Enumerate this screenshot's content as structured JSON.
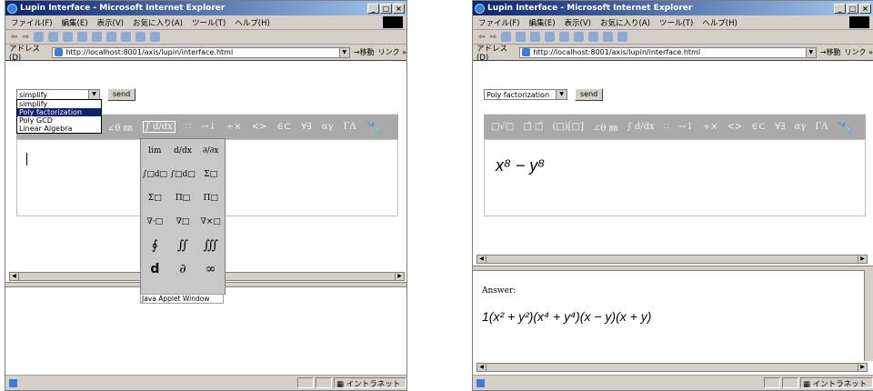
{
  "window": {
    "title": "Lupin Interface - Microsoft Internet Explorer",
    "menu": [
      "ファイル(F)",
      "編集(E)",
      "表示(V)",
      "お気に入り(A)",
      "ツール(T)",
      "ヘルプ(H)"
    ],
    "address_label": "アドレス(D)",
    "url": "http://localhost:8001/axis/lupin/interface.html",
    "go_label": "移動",
    "links_label": "リンク »",
    "status_zone": "イントラネット"
  },
  "left": {
    "select_value": "simplify",
    "send_label": "send",
    "options": [
      "simplify",
      "Poly factorization",
      "Poly GCD",
      "Linear Algebra"
    ],
    "selected_option": "Poly factorization",
    "palette_visible": [
      "∠θ ㎜",
      "∫ d/dx",
      "∷",
      "→↓",
      "÷×",
      "<>",
      "∈⊂",
      "∀∃",
      "αγ",
      "ΓΛ"
    ],
    "popup_symbols": [
      "lim",
      "d/dx",
      "∂/∂x",
      "∫□d□",
      "∫□d□",
      "Σ□",
      "Σ□",
      "Π□",
      "Π□",
      "∇·□",
      "∇□",
      "∇×□",
      "∮",
      "∬",
      "∭",
      "d",
      "∂",
      "∞"
    ],
    "popup_label": "Java Applet Window"
  },
  "right": {
    "select_value": "Poly factorization",
    "send_label": "send",
    "palette": [
      "□√□",
      "□̄ □̂",
      "(□)[□]",
      "∠θ ㎜",
      "∫ d/dx",
      "∷",
      "→↓",
      "÷×",
      "<>",
      "∈⊂",
      "∀∃",
      "αγ",
      "ΓΛ"
    ],
    "expression": "x⁸ − y⁸",
    "answer_label": "Answer:",
    "answer": "1(x² + y²)(x⁴ + y⁴)(x − y)(x + y)"
  }
}
